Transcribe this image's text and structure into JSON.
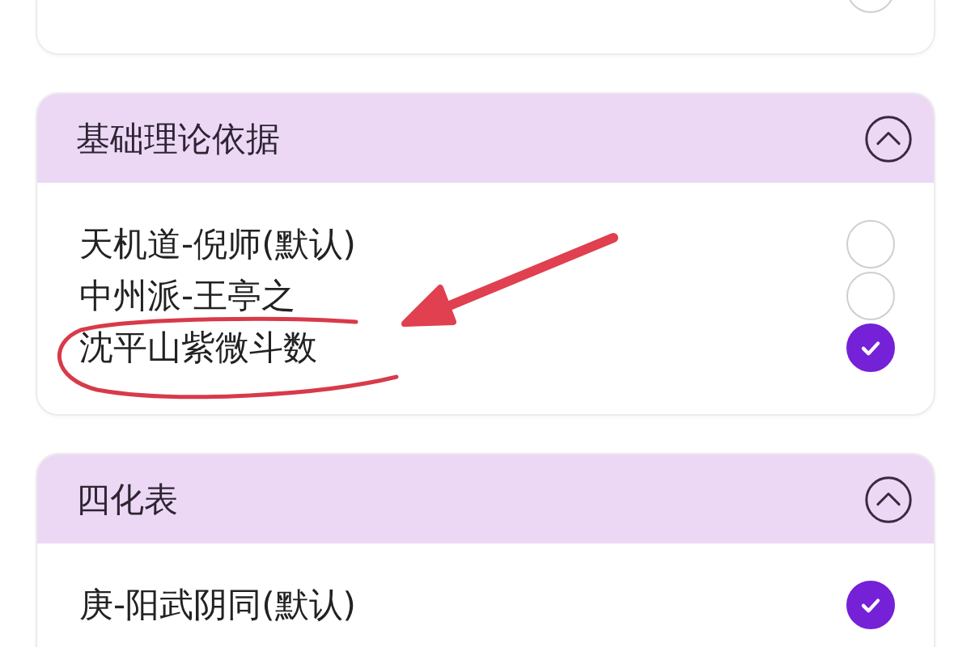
{
  "top_card": {
    "option_selected": false
  },
  "sections": [
    {
      "title": "基础理论依据",
      "expanded": true,
      "options": [
        {
          "label": "天机道-倪师(默认)",
          "selected": false
        },
        {
          "label": "中州派-王亭之",
          "selected": false
        },
        {
          "label": "沈平山紫微斗数",
          "selected": true
        }
      ]
    },
    {
      "title": "四化表",
      "expanded": true,
      "options": [
        {
          "label": "庚-阳武阴同(默认)",
          "selected": true
        }
      ]
    }
  ]
}
